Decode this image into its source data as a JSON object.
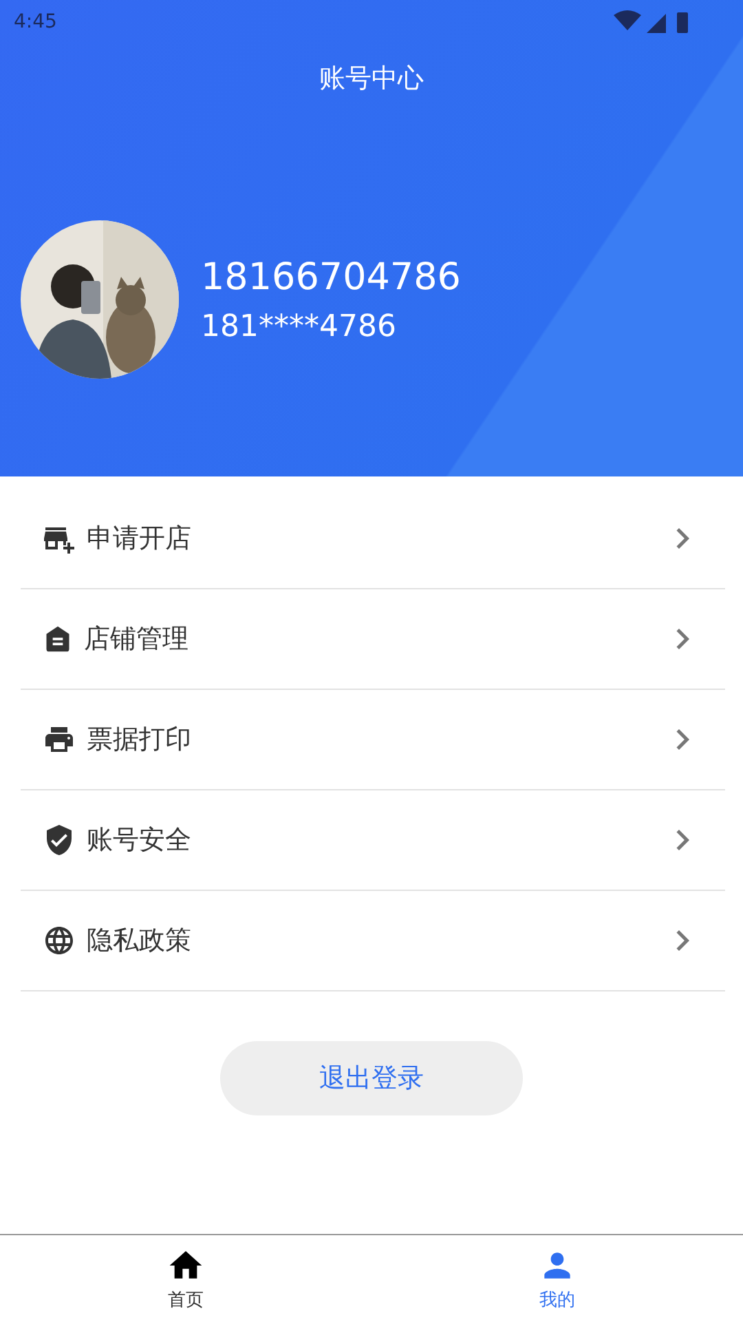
{
  "status_bar": {
    "time": "4:45"
  },
  "header": {
    "title": "账号中心"
  },
  "profile": {
    "name": "18166704786",
    "phone": "181****4786"
  },
  "menu": [
    {
      "label": "申请开店"
    },
    {
      "label": "店铺管理"
    },
    {
      "label": "票据打印"
    },
    {
      "label": "账号安全"
    },
    {
      "label": "隐私政策"
    }
  ],
  "logout_button": "退出登录",
  "tabs": [
    {
      "label": "首页",
      "selected": false
    },
    {
      "label": "我的",
      "selected": true
    }
  ]
}
